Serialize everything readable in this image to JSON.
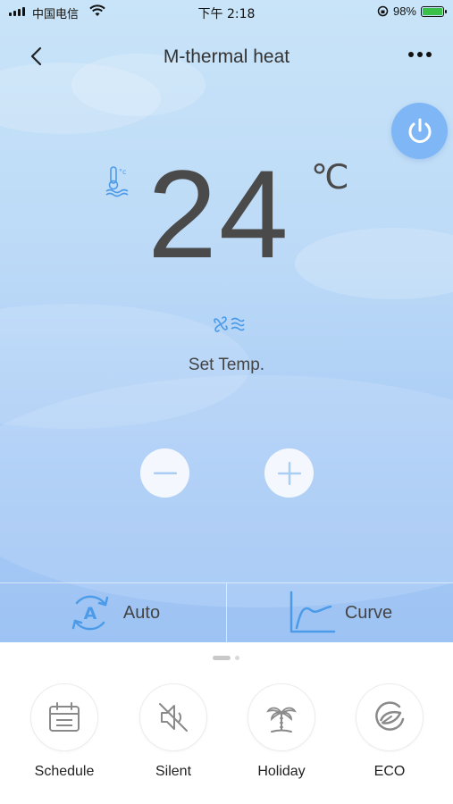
{
  "status_bar": {
    "carrier": "中国电信",
    "time": "下午 2:18",
    "battery": "98%",
    "battery_level": 0.98
  },
  "nav": {
    "title": "M-thermal heat"
  },
  "temperature": {
    "value": "24",
    "unit": "℃",
    "caption": "Set Temp."
  },
  "controls": {
    "decrease_icon": "minus-icon",
    "increase_icon": "plus-icon",
    "power_icon": "power-icon"
  },
  "modes": [
    {
      "label": "Auto",
      "icon": "auto-mode-icon"
    },
    {
      "label": "Curve",
      "icon": "curve-icon"
    }
  ],
  "functions": [
    {
      "label": "Schedule",
      "icon": "calendar-icon"
    },
    {
      "label": "Silent",
      "icon": "mute-icon"
    },
    {
      "label": "Holiday",
      "icon": "palm-tree-icon"
    },
    {
      "label": "ECO",
      "icon": "eco-leaf-icon"
    }
  ],
  "colors": {
    "accent": "#5aa4ee",
    "power_button": "#7fb6f5",
    "background_top": "#c9e4f8",
    "background_bottom": "#9dc3f4"
  },
  "pager": {
    "pages": 2,
    "current": 1
  }
}
